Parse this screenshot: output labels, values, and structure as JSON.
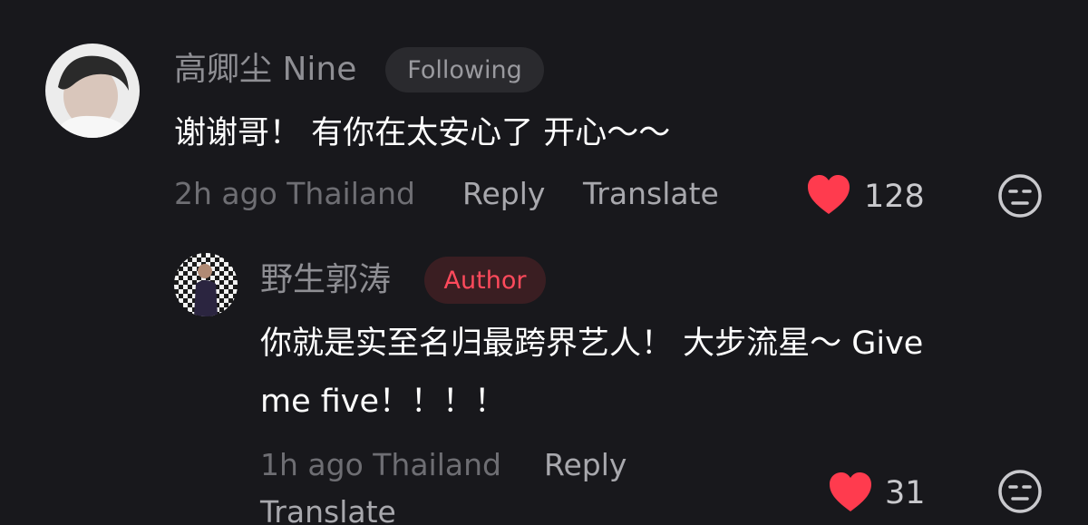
{
  "comment": {
    "username": "高卿尘 Nine",
    "badge": "Following",
    "text": "谢谢哥！ 有你在太安心了 开心～～",
    "time_location": "2h ago Thailand",
    "reply_label": "Reply",
    "translate_label": "Translate",
    "like_count": "128",
    "like_icon": "heart-icon",
    "reaction_icon": "neutral-face-icon"
  },
  "reply": {
    "username": "野生郭涛",
    "badge": "Author",
    "text_line1": "你就是实至名归最跨界艺人！ 大步流星～ Give",
    "text_line2": "me five！！！！",
    "time_location": "1h ago Thailand",
    "reply_label": "Reply",
    "translate_label": "Translate",
    "like_count": "31",
    "like_icon": "heart-icon",
    "reaction_icon": "neutral-face-icon"
  },
  "colors": {
    "background": "#18181c",
    "like": "#ff3b4e",
    "author_badge_text": "#ff4a5c"
  }
}
